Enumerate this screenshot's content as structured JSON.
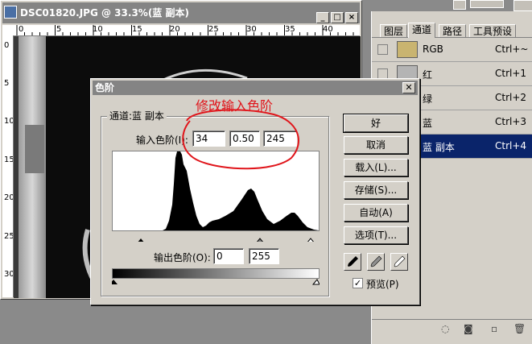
{
  "document": {
    "title": "DSC01820.JPG @ 33.3%(蓝 副本)",
    "ruler_top": [
      "0",
      "5",
      "10",
      "15",
      "20",
      "25",
      "30",
      "35",
      "40"
    ],
    "ruler_left": [
      "0",
      "5",
      "10",
      "15",
      "20",
      "25",
      "30"
    ]
  },
  "panel": {
    "tabs": [
      "图层",
      "通道",
      "路径",
      "工具预设"
    ],
    "active_tab": 1,
    "channels": [
      {
        "name": "RGB",
        "shortcut": "Ctrl+~",
        "thumb_color": "#c9b470"
      },
      {
        "name": "红",
        "shortcut": "Ctrl+1",
        "thumb_color": "#b4b4b4"
      },
      {
        "name": "绿",
        "shortcut": "Ctrl+2",
        "thumb_color": "#a0a0a0"
      },
      {
        "name": "蓝",
        "shortcut": "Ctrl+3",
        "thumb_color": "#8c8c8c"
      },
      {
        "name": "蓝 副本",
        "shortcut": "Ctrl+4",
        "thumb_color": "#787878",
        "selected": true
      }
    ]
  },
  "dialog": {
    "title": "色阶",
    "channel_label": "通道:蓝 副本",
    "input_levels_label": "输入色阶(I):",
    "input_values": [
      "34",
      "0.50",
      "245"
    ],
    "output_levels_label": "输出色阶(O):",
    "output_values": [
      "0",
      "255"
    ],
    "buttons": {
      "ok": "好",
      "cancel": "取消",
      "load": "载入(L)...",
      "save": "存储(S)...",
      "auto": "自动(A)",
      "options": "选项(T)..."
    },
    "preview_label": "预览(P)",
    "preview_checked": true
  },
  "annotation": {
    "text": "修改输入色阶",
    "color": "#e0151b"
  }
}
